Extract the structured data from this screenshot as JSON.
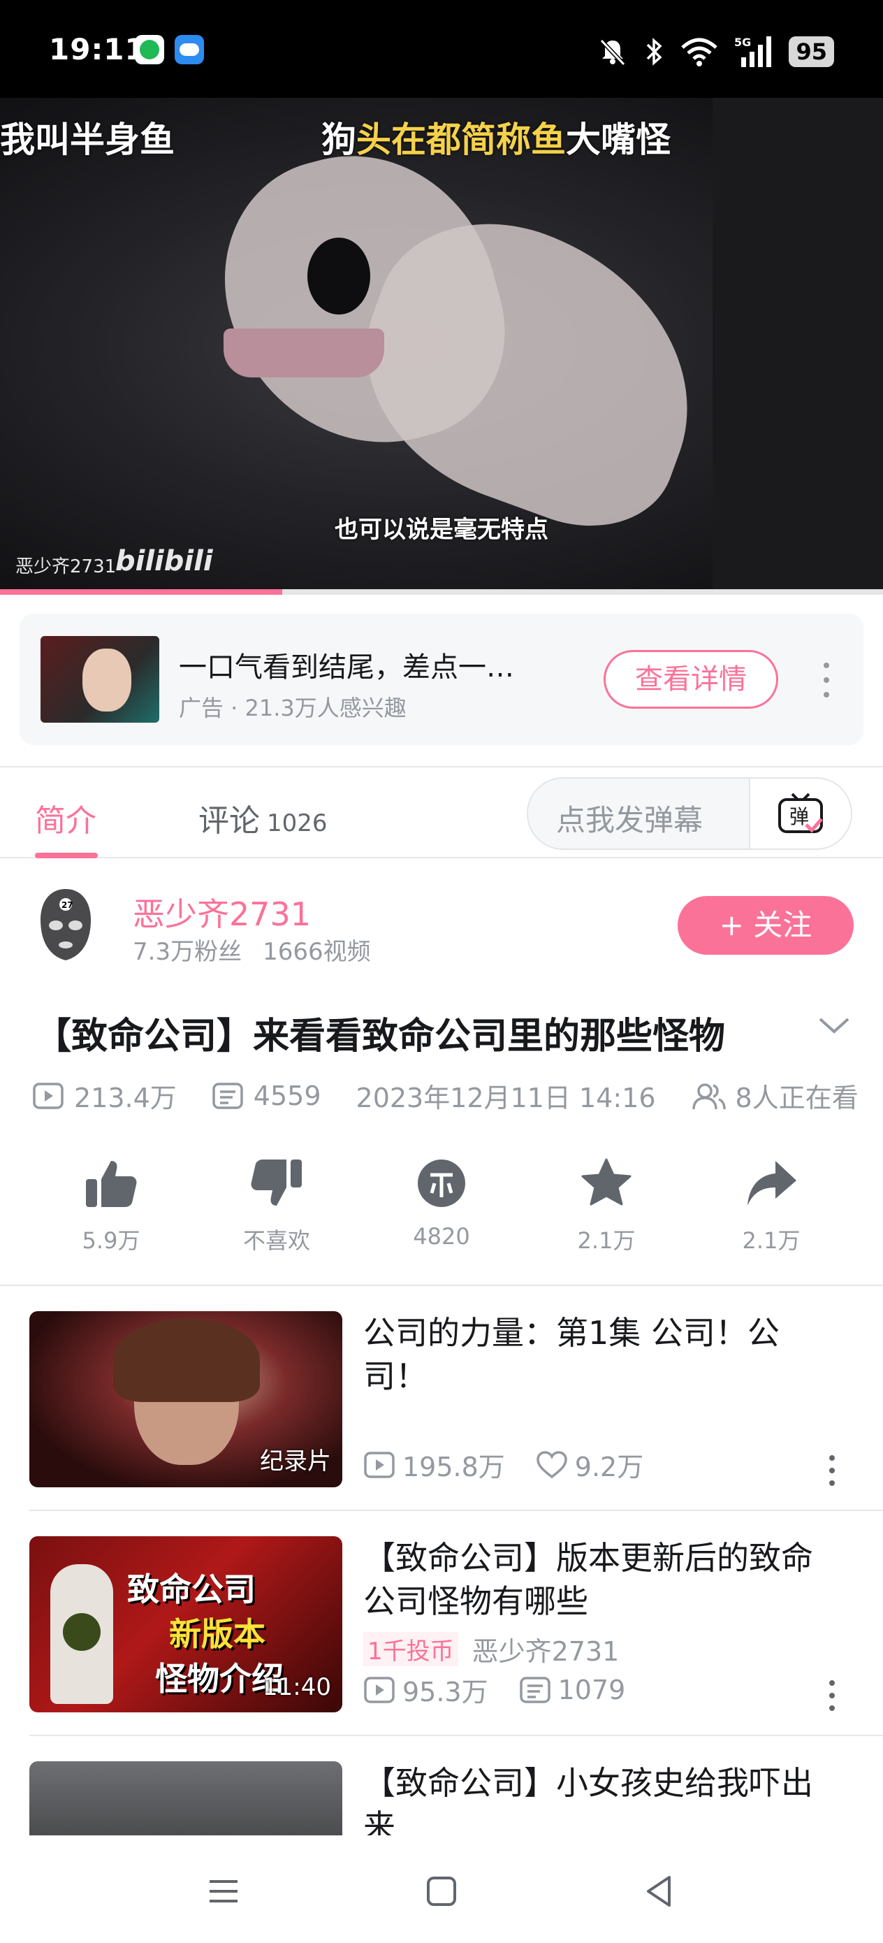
{
  "status_bar": {
    "time": "19:11",
    "battery": "95",
    "network": "5G"
  },
  "video": {
    "subtitle_left": "我叫半身鱼",
    "subtitle_right_pre": "狗",
    "subtitle_right_hl": "头在都简称鱼",
    "subtitle_right_post": "大嘴怪",
    "subtitle_bottom": "也可以说是毫无特点",
    "watermark_user": "恶少齐2731",
    "watermark_logo": "bilibili",
    "progress": 0.32
  },
  "ad": {
    "title": "一口气看到结尾，差点一…",
    "subtitle": "广告 · 21.3万人感兴趣",
    "button": "查看详情"
  },
  "tabs": {
    "intro": "简介",
    "comments": "评论",
    "comments_count": "1026",
    "danmaku_placeholder": "点我发弹幕"
  },
  "uploader": {
    "name": "恶少齐2731",
    "fans": "7.3万粉丝",
    "videos": "1666视频",
    "follow": "+ 关注"
  },
  "video_info": {
    "title": "【致命公司】来看看致命公司里的那些怪物",
    "views": "213.4万",
    "danmaku": "4559",
    "date": "2023年12月11日 14:16",
    "watching": "8人正在看"
  },
  "actions": {
    "like": "5.9万",
    "dislike": "不喜欢",
    "coin": "4820",
    "favorite": "2.1万",
    "share": "2.1万"
  },
  "related": [
    {
      "title": "公司的力量：第1集 公司！公司！",
      "badge": "纪录片",
      "views": "195.8万",
      "likes": "9.2万"
    },
    {
      "title": "【致命公司】版本更新后的致命公司怪物有哪些",
      "duration": "11:40",
      "coin_tag": "1千投币",
      "author": "恶少齐2731",
      "views": "95.3万",
      "danmaku": "1079",
      "thumb_text_1": "致命公司",
      "thumb_text_2": "新版本",
      "thumb_text_3": "怪物介绍"
    },
    {
      "title": "【致命公司】小女孩史给我吓出来"
    }
  ],
  "colors": {
    "accent": "#fb7299",
    "text_secondary": "#9499a0"
  }
}
